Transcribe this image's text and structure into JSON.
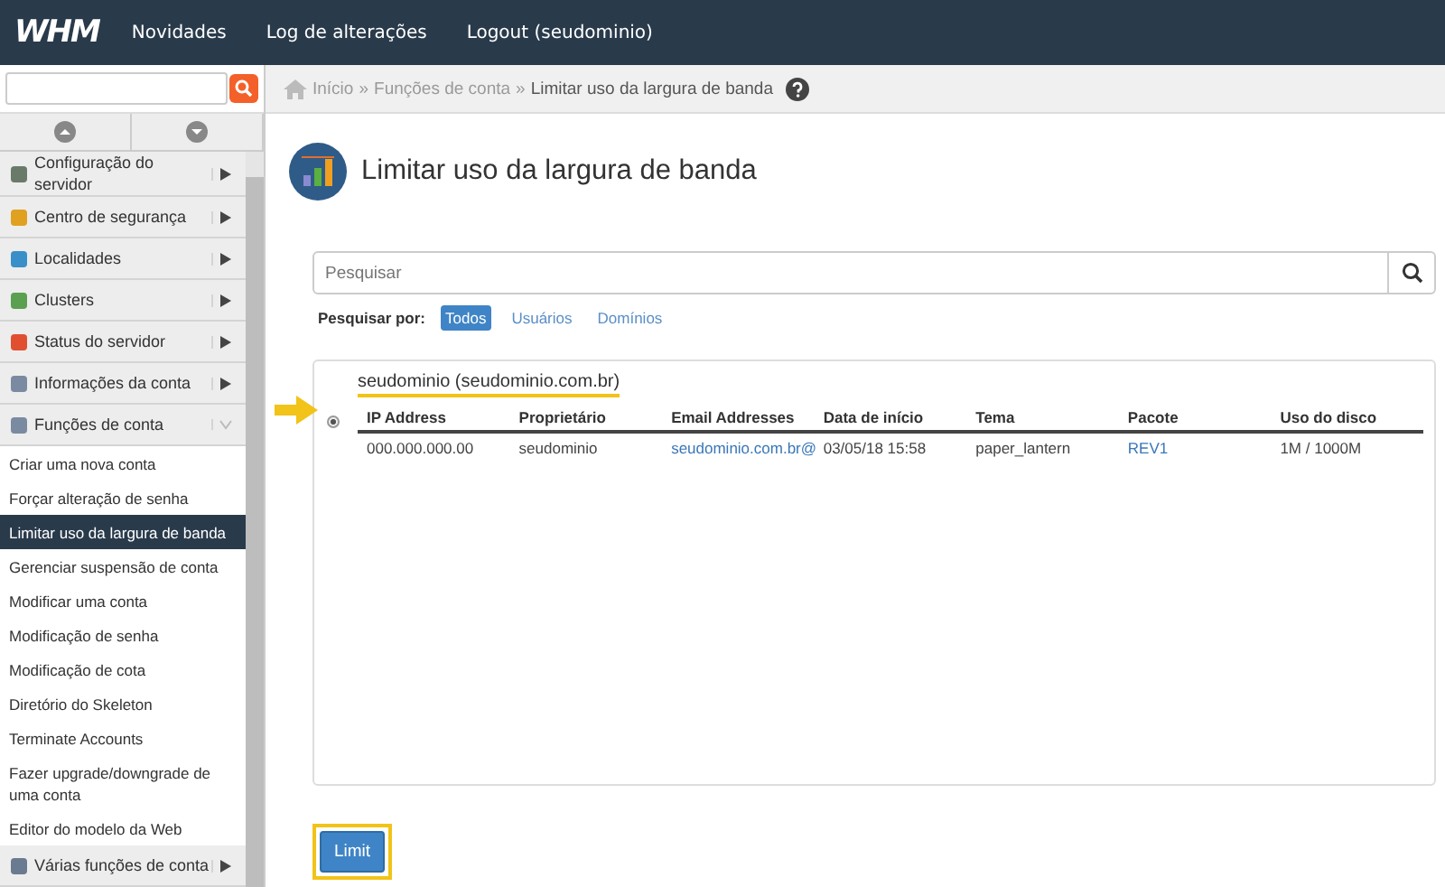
{
  "topbar": {
    "logo": "WHM",
    "links": [
      "Novidades",
      "Log de alterações",
      "Logout (seudominio)"
    ]
  },
  "breadcrumb": {
    "separator": "»",
    "items": [
      "Início",
      "Funções de conta",
      "Limitar uso da largura de banda"
    ]
  },
  "sidebar": {
    "items": [
      {
        "kind": "section",
        "label": "Configuração do servidor",
        "expanded": false
      },
      {
        "kind": "section",
        "label": "Centro de segurança",
        "expanded": false
      },
      {
        "kind": "section",
        "label": "Localidades",
        "expanded": false
      },
      {
        "kind": "section",
        "label": "Clusters",
        "expanded": false
      },
      {
        "kind": "section",
        "label": "Status do servidor",
        "expanded": false
      },
      {
        "kind": "section",
        "label": "Informações da conta",
        "expanded": false
      },
      {
        "kind": "section",
        "label": "Funções de conta",
        "expanded": true
      },
      {
        "kind": "sub",
        "label": "Criar uma nova conta",
        "selected": false
      },
      {
        "kind": "sub",
        "label": "Forçar alteração de senha",
        "selected": false
      },
      {
        "kind": "sub",
        "label": "Limitar uso da largura de banda",
        "selected": true
      },
      {
        "kind": "sub",
        "label": "Gerenciar suspensão de conta",
        "selected": false
      },
      {
        "kind": "sub",
        "label": "Modificar uma conta",
        "selected": false
      },
      {
        "kind": "sub",
        "label": "Modificação de senha",
        "selected": false
      },
      {
        "kind": "sub",
        "label": "Modificação de cota",
        "selected": false
      },
      {
        "kind": "sub",
        "label": "Diretório do Skeleton",
        "selected": false
      },
      {
        "kind": "sub",
        "label": "Terminate Accounts",
        "selected": false
      },
      {
        "kind": "sub",
        "label": "Fazer upgrade/downgrade de uma conta",
        "selected": false
      },
      {
        "kind": "sub",
        "label": "Editor do modelo da Web",
        "selected": false
      },
      {
        "kind": "section",
        "label": "Várias funções de conta",
        "expanded": false
      }
    ]
  },
  "page": {
    "title": "Limitar uso da largura de banda"
  },
  "search": {
    "placeholder": "Pesquisar"
  },
  "filter": {
    "label": "Pesquisar por:",
    "options": [
      {
        "label": "Todos",
        "selected": true
      },
      {
        "label": "Usuários",
        "selected": false
      },
      {
        "label": "Domínios",
        "selected": false
      }
    ]
  },
  "account": {
    "title": "seudominio (seudominio.com.br)",
    "selected": true,
    "columns": [
      "IP Address",
      "Proprietário",
      "Email Addresses",
      "Data de início",
      "Tema",
      "Pacote",
      "Uso do disco"
    ],
    "cells": [
      {
        "kind": "text",
        "text": "000.000.000.00"
      },
      {
        "kind": "text",
        "text": "seudominio"
      },
      {
        "kind": "link",
        "text": "seudominio.com.br@"
      },
      {
        "kind": "text",
        "text": "03/05/18 15:58"
      },
      {
        "kind": "text",
        "text": "paper_lantern"
      },
      {
        "kind": "link",
        "text": "REV1"
      },
      {
        "kind": "text",
        "text": "1M / 1000M"
      }
    ]
  },
  "button": {
    "label": "Limit"
  }
}
